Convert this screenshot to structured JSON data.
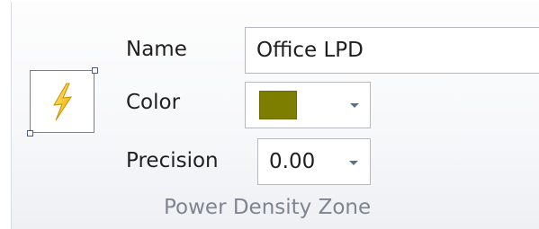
{
  "ribbon_group": {
    "caption": "Power Density Zone",
    "icon": "lightning-bolt-icon",
    "fields": {
      "name_label": "Name",
      "name_value": "Office LPD",
      "color_label": "Color",
      "color_value": "#7d7d00",
      "precision_label": "Precision",
      "precision_value": "0.00"
    }
  }
}
